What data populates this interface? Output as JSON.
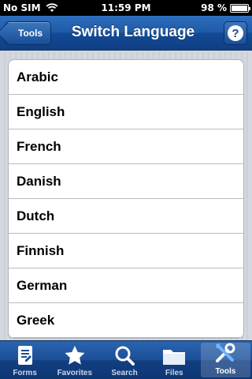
{
  "status_bar": {
    "carrier": "No SIM",
    "time": "11:59 PM",
    "battery_text": "98 %",
    "battery_level": 0.98
  },
  "nav": {
    "back_label": "Tools",
    "title": "Switch Language",
    "help_label": "?"
  },
  "languages": [
    "Arabic",
    "English",
    "French",
    "Danish",
    "Dutch",
    "Finnish",
    "German",
    "Greek"
  ],
  "tabs": [
    {
      "label": "Forms",
      "icon": "forms-icon",
      "active": false
    },
    {
      "label": "Favorites",
      "icon": "star-icon",
      "active": false
    },
    {
      "label": "Search",
      "icon": "search-icon",
      "active": false
    },
    {
      "label": "Files",
      "icon": "folder-icon",
      "active": false
    },
    {
      "label": "Tools",
      "icon": "tools-icon",
      "active": true
    }
  ],
  "colors": {
    "nav_bar": "#1e5aa8",
    "tab_bar": "#1b4f98",
    "content_bg": "#cfd3da"
  }
}
